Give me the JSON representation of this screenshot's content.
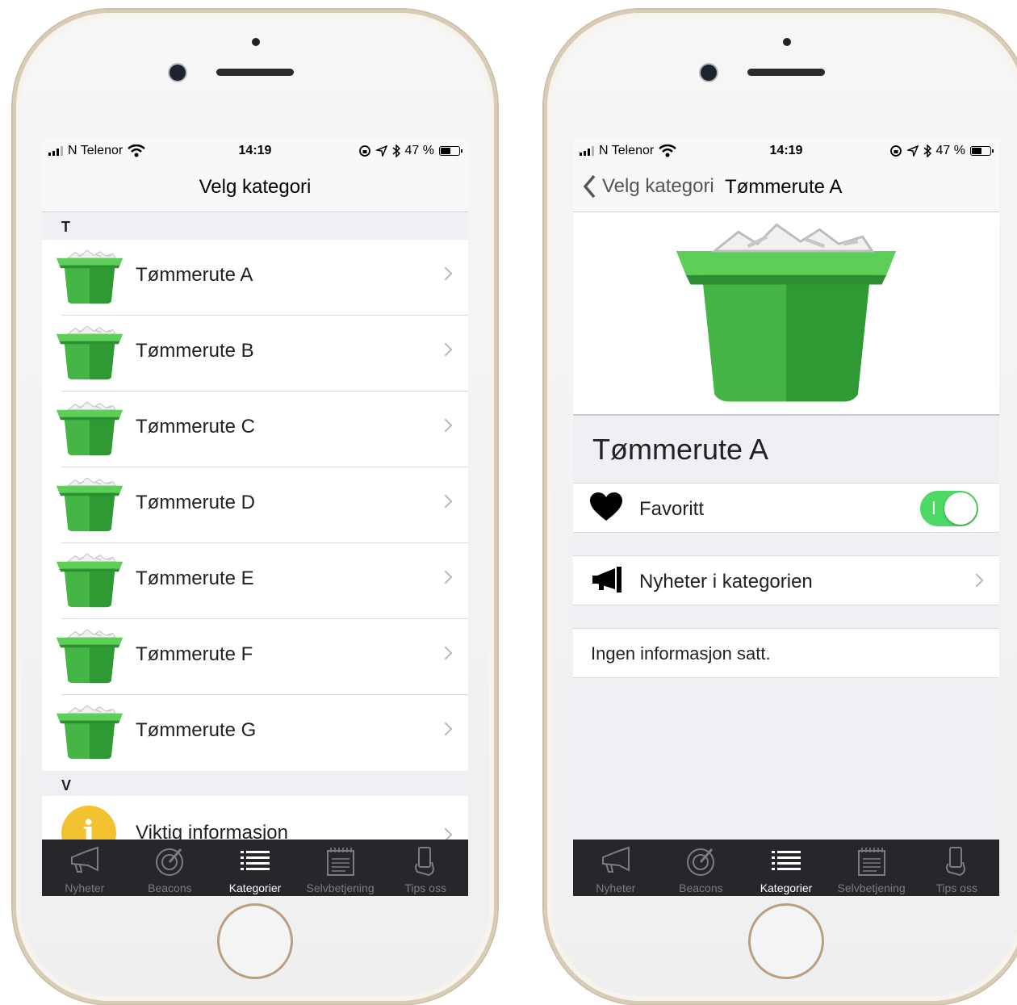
{
  "status": {
    "carrier": "N Telenor",
    "time": "14:19",
    "battery": "47 %"
  },
  "list_screen": {
    "title": "Velg kategori",
    "sections": [
      {
        "header": "T",
        "items": [
          "Tømmerute A",
          "Tømmerute B",
          "Tømmerute C",
          "Tømmerute D",
          "Tømmerute E",
          "Tømmerute F",
          "Tømmerute G"
        ]
      },
      {
        "header": "V",
        "items": [
          "Viktig informasjon"
        ]
      }
    ]
  },
  "detail_screen": {
    "back_label": "Velg kategori",
    "nav_title": "Tømmerute A",
    "title": "Tømmerute A",
    "favorite_label": "Favoritt",
    "favorite_on": true,
    "news_label": "Nyheter i kategorien",
    "info_text": "Ingen informasjon satt."
  },
  "tabbar": {
    "tabs": [
      {
        "label": "Nyheter",
        "icon": "megaphone-icon"
      },
      {
        "label": "Beacons",
        "icon": "radar-icon"
      },
      {
        "label": "Kategorier",
        "icon": "list-icon",
        "active": true
      },
      {
        "label": "Selvbetjening",
        "icon": "notepad-icon"
      },
      {
        "label": "Tips oss",
        "icon": "phone-hand-icon"
      }
    ]
  },
  "colors": {
    "accent_green": "#4cd964",
    "bin_green": "#3fae3f",
    "tabbar_bg": "#25272a",
    "info_yellow": "#f2c230"
  }
}
